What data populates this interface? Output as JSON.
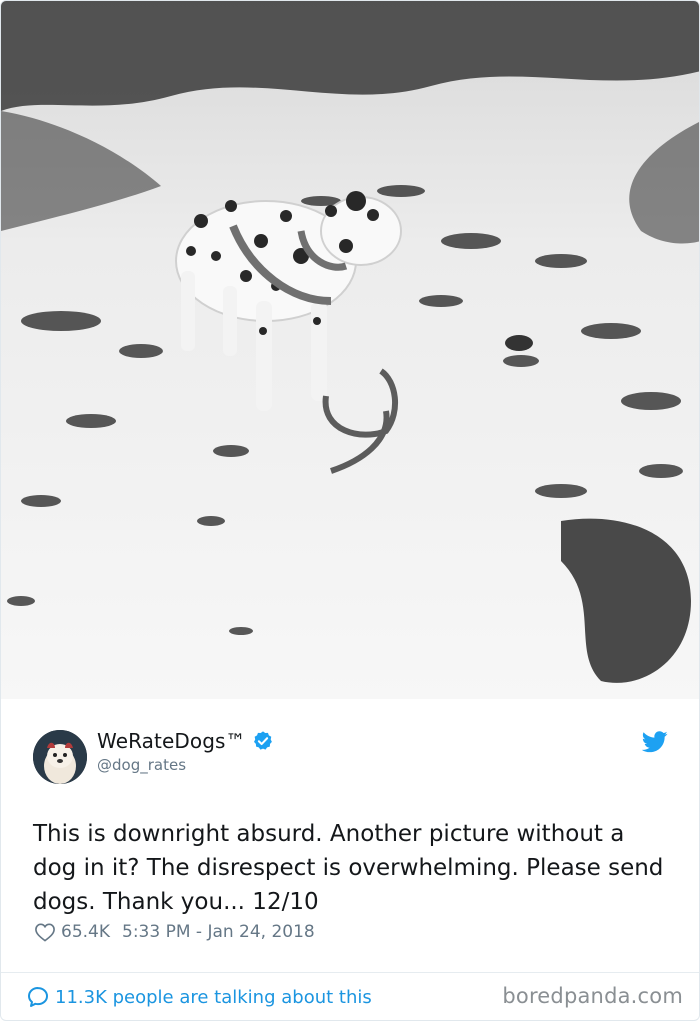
{
  "tweet": {
    "photo_alt": "",
    "author": {
      "display_name": "WeRateDogs™",
      "handle": "@dog_rates",
      "verified": true,
      "avatar_icon": "dog-avatar"
    },
    "text": "This is downright absurd. Another picture without a dog in it? The disrespect is overwhelming. Please send dogs. Thank you... 12/10",
    "likes": "65.4K",
    "timestamp": "5:33 PM - Jan 24, 2018",
    "talking": "11.3K people are talking about this"
  },
  "watermark": "boredpanda.com",
  "icons": {
    "verified": "verified-badge-icon",
    "platform": "twitter-bird-icon",
    "like": "heart-icon",
    "comment": "speech-bubble-icon"
  },
  "colors": {
    "accent": "#1b95e0",
    "verified": "#1da1f2",
    "muted": "#657786",
    "text": "#14171a",
    "border": "#e1e8ed"
  }
}
